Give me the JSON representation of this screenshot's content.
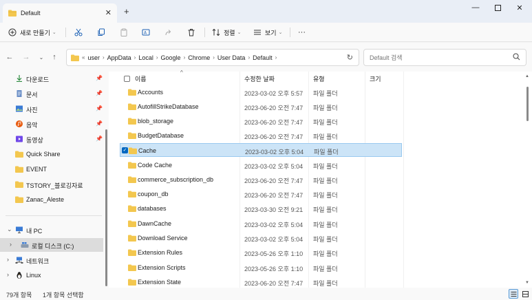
{
  "window": {
    "tab_title": "Default",
    "colors": {
      "folder": "#f3c74f",
      "accent": "#0067c0",
      "selection": "#cce4f7"
    }
  },
  "toolbar": {
    "new_label": "새로 만들기",
    "sort_label": "정렬",
    "view_label": "보기",
    "more_label": "···"
  },
  "address": {
    "overflow": "«",
    "crumbs": [
      "user",
      "AppData",
      "Local",
      "Google",
      "Chrome",
      "User Data",
      "Default"
    ]
  },
  "search": {
    "placeholder": "Default 검색"
  },
  "sidebar": {
    "quick": [
      {
        "label": "다운로드",
        "icon": "download-icon"
      },
      {
        "label": "문서",
        "icon": "document-icon"
      },
      {
        "label": "사진",
        "icon": "picture-icon"
      },
      {
        "label": "음악",
        "icon": "music-icon"
      },
      {
        "label": "동영상",
        "icon": "video-icon"
      },
      {
        "label": "Quick Share",
        "icon": "folder-icon"
      },
      {
        "label": "EVENT",
        "icon": "folder-icon"
      },
      {
        "label": "TSTORY_블로깅자료",
        "icon": "folder-icon"
      },
      {
        "label": "Zanac_Aleste",
        "icon": "folder-icon"
      }
    ],
    "tree": [
      {
        "label": "내 PC",
        "icon": "pc-icon"
      },
      {
        "label": "로컬 디스크 (C:)",
        "icon": "drive-icon"
      },
      {
        "label": "네트워크",
        "icon": "network-icon"
      },
      {
        "label": "Linux",
        "icon": "linux-icon"
      }
    ]
  },
  "columns": {
    "name": "이름",
    "modified": "수정한 날짜",
    "type": "유형",
    "size": "크기"
  },
  "files": [
    {
      "name": "Accounts",
      "date": "2023-03-02 오후 5:57",
      "type": "파일 폴더"
    },
    {
      "name": "AutofillStrikeDatabase",
      "date": "2023-06-20 오전 7:47",
      "type": "파일 폴더"
    },
    {
      "name": "blob_storage",
      "date": "2023-06-20 오전 7:47",
      "type": "파일 폴더"
    },
    {
      "name": "BudgetDatabase",
      "date": "2023-06-20 오전 7:47",
      "type": "파일 폴더"
    },
    {
      "name": "Cache",
      "date": "2023-03-02 오후 5:04",
      "type": "파일 폴더"
    },
    {
      "name": "Code Cache",
      "date": "2023-03-02 오후 5:04",
      "type": "파일 폴더"
    },
    {
      "name": "commerce_subscription_db",
      "date": "2023-06-20 오전 7:47",
      "type": "파일 폴더"
    },
    {
      "name": "coupon_db",
      "date": "2023-06-20 오전 7:47",
      "type": "파일 폴더"
    },
    {
      "name": "databases",
      "date": "2023-03-30 오전 9:21",
      "type": "파일 폴더"
    },
    {
      "name": "DawnCache",
      "date": "2023-03-02 오후 5:04",
      "type": "파일 폴더"
    },
    {
      "name": "Download Service",
      "date": "2023-03-02 오후 5:04",
      "type": "파일 폴더"
    },
    {
      "name": "Extension Rules",
      "date": "2023-05-26 오후 1:10",
      "type": "파일 폴더"
    },
    {
      "name": "Extension Scripts",
      "date": "2023-05-26 오후 1:10",
      "type": "파일 폴더"
    },
    {
      "name": "Extension State",
      "date": "2023-06-20 오전 7:47",
      "type": "파일 폴더"
    }
  ],
  "status": {
    "count": "79개 항목",
    "selected": "1개 항목 선택함"
  }
}
